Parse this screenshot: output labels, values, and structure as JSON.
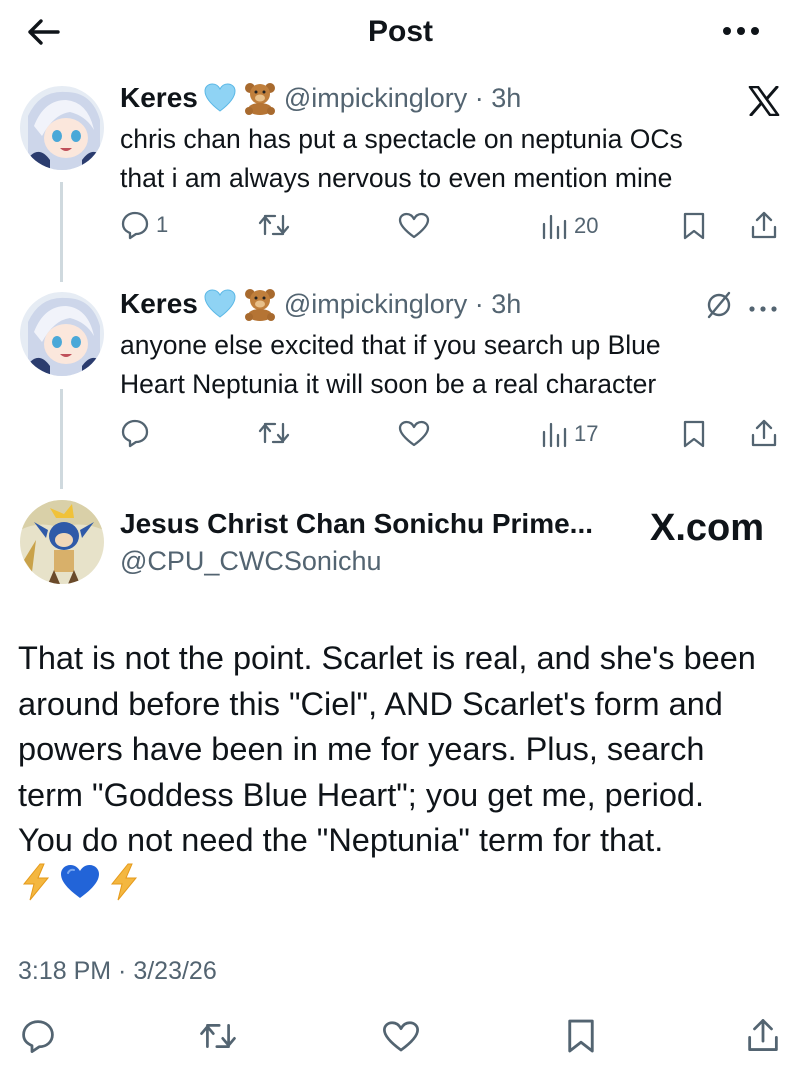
{
  "header": {
    "title": "Post"
  },
  "tweets": [
    {
      "name": "Keres",
      "handle_time": "@impickinglory · 3h",
      "text": "chris chan has put a spectacle on neptunia OCs\nthat i am always nervous to even mention mine",
      "replies": "1",
      "views": "20"
    },
    {
      "name": "Keres",
      "handle_time": "@impickinglory · 3h",
      "text": "anyone else excited that if you search up Blue\nHeart Neptunia it will soon be a real character",
      "replies": "",
      "views": "17"
    }
  ],
  "main_post": {
    "name": "Jesus Christ Chan Sonichu Prime...",
    "handle": "@CPU_CWCSonichu",
    "watermark": "X.com",
    "text": "That is not the point. Scarlet is real, and she's been\naround before this \"Ciel\", AND Scarlet's form and\npowers have been in me for years. Plus, search\nterm \"Goddess Blue Heart\"; you get me, period.\nYou do not need the \"Neptunia\" term for that.",
    "timestamp": "3:18 PM · 3/23/26"
  },
  "icons": {
    "back": "arrow-left-icon",
    "more": "more-dots-icon",
    "x_logo": "x-logo-icon",
    "reply": "reply-icon",
    "retweet": "retweet-icon",
    "like": "heart-icon",
    "views": "views-icon",
    "bookmark": "bookmark-icon",
    "share": "share-icon",
    "blue_heart": "blue-heart-emoji",
    "teddy": "teddy-bear-emoji",
    "lightning": "lightning-emoji"
  },
  "colors": {
    "text": "#0f1419",
    "muted": "#536471",
    "thread": "#cfd9de",
    "heart_blue": "#8fd3f4"
  }
}
